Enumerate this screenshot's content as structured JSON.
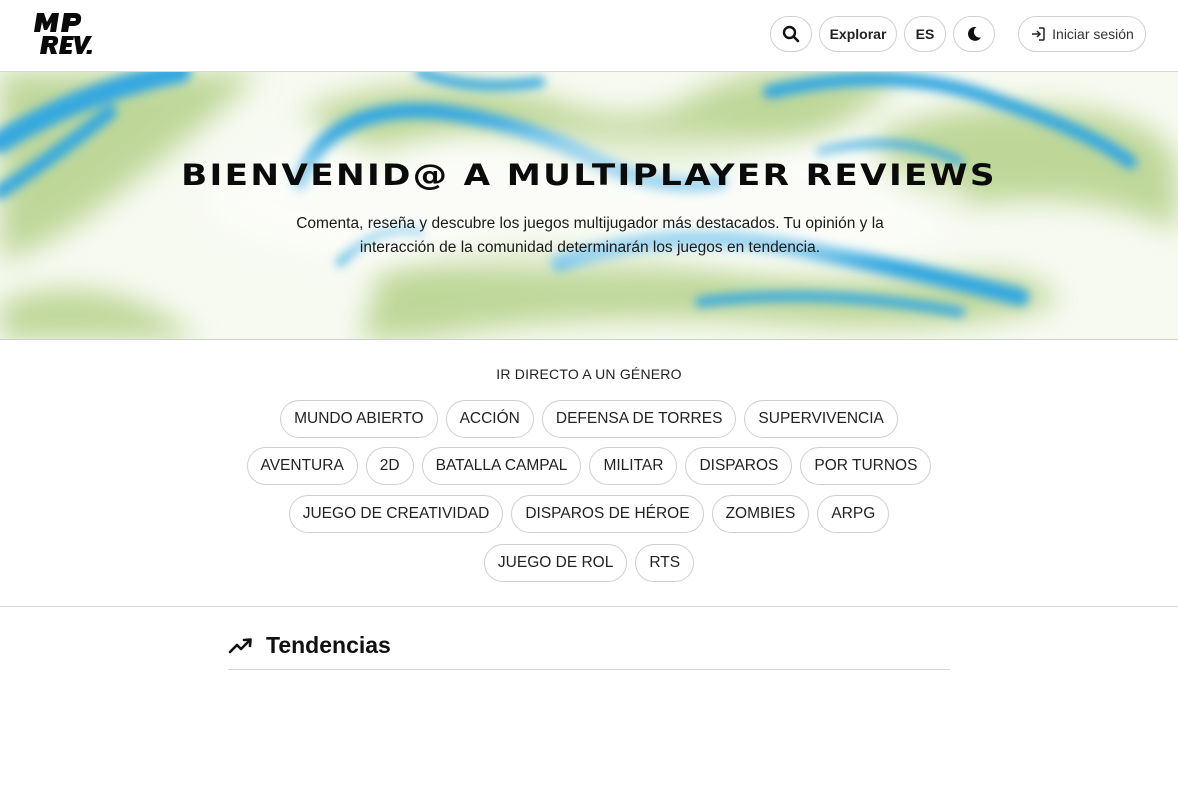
{
  "header": {
    "logo_text": "MP REV.",
    "search_icon": "search-icon",
    "explore_label": "Explorar",
    "lang_label": "ES",
    "theme_icon": "moon-icon",
    "login_icon": "sign-in-icon",
    "login_label": "Iniciar sesión"
  },
  "hero": {
    "title": "BIENVENID@ A MULTIPLAYER REVIEWS",
    "subtitle_line1": "Comenta, reseña y descubre los juegos multijugador más destacados. Tu opinión y la",
    "subtitle_line2": "interacción de la comunidad determinarán los juegos en tendencia.",
    "colors": {
      "blue": "#35a8e0",
      "green": "#a9c97a",
      "bg": "#f6f9ef"
    }
  },
  "genres": {
    "title": "IR DIRECTO A UN GÉNERO",
    "rows": [
      [
        "MUNDO ABIERTO",
        "ACCIÓN",
        "DEFENSA DE TORRES",
        "SUPERVIVENCIA"
      ],
      [
        "AVENTURA",
        "2D",
        "BATALLA CAMPAL",
        "MILITAR",
        "DISPAROS",
        "POR TURNOS"
      ],
      [
        "JUEGO DE CREATIVIDAD",
        "DISPAROS DE HÉROE",
        "ZOMBIES",
        "ARPG"
      ],
      [
        "JUEGO DE ROL",
        "RTS"
      ]
    ]
  },
  "trending": {
    "icon": "trending-up-icon",
    "title": "Tendencias"
  }
}
